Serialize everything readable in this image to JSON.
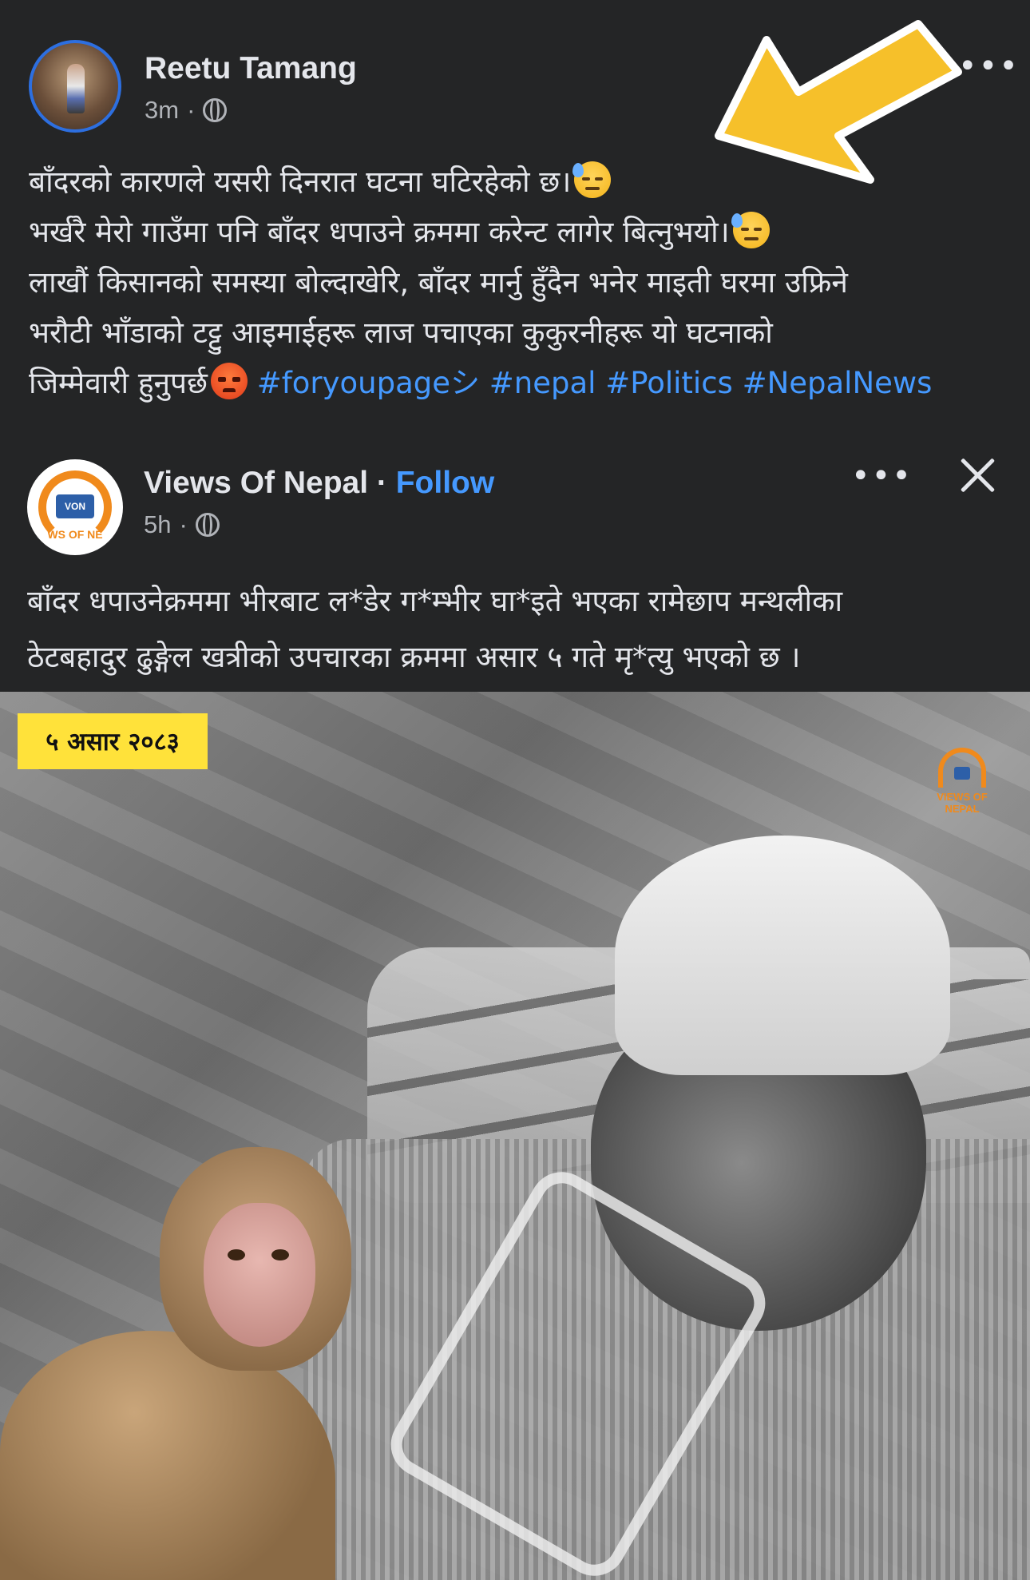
{
  "post": {
    "author": "Reetu Tamang",
    "time": "3m",
    "time_sep": "·",
    "more": "•••",
    "lines": [
      "बाँदरको कारणले यसरी दिनरात घटना घटिरहेको छ।",
      "भर्खरै मेरो गाउँमा पनि बाँदर धपाउने क्रममा करेन्ट लागेर बित्नुभयो।",
      "लाखौं किसानको समस्या बोल्दाखेरि, बाँदर मार्नु हुँदैन भनेर माइती घरमा उफ्रिने",
      "भरौटी भाँडाको टट्टु आइमाईहरू लाज पचाएका कुकुरनीहरू यो घटनाको",
      "जिम्मेवारी हुनुपर्छ"
    ],
    "hashtags": "#foryoupageシ #nepal #Politics #NepalNews",
    "emojis": [
      "sweat-face-icon",
      "angry-face-icon"
    ]
  },
  "shared": {
    "page_name": "Views Of Nepal",
    "dot": " · ",
    "follow": "Follow",
    "time": "5h",
    "time_sep": "·",
    "more": "•••",
    "avatar_text": "VON",
    "avatar_band": "WS OF NE",
    "lines": [
      "बाँदर धपाउनेक्रममा भीरबाट ल*डेर ग*म्भीर घा*इते भएका रामेछाप मन्थलीका",
      "ठेटबहादुर ढुङ्गेल खत्रीको उपचारका क्रममा असार ५ गते मृ*त्यु भएको छ ।"
    ]
  },
  "image": {
    "date_badge": "५ असार २०८३",
    "watermark": "VIEWS OF NEPAL"
  },
  "colors": {
    "background": "#242526",
    "link": "#4599ff",
    "badge": "#ffe23a",
    "arrow": "#f6c02a",
    "brand_orange": "#f08a1c"
  }
}
